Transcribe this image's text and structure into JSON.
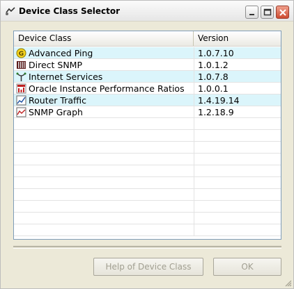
{
  "window": {
    "title": "Device Class Selector"
  },
  "list": {
    "headers": {
      "device_class": "Device Class",
      "version": "Version"
    },
    "rows": [
      {
        "name": "Advanced Ping",
        "version": "1.0.7.10",
        "icon": "advanced-ping-icon"
      },
      {
        "name": "Direct SNMP",
        "version": "1.0.1.2",
        "icon": "direct-snmp-icon"
      },
      {
        "name": "Internet Services",
        "version": "1.0.7.8",
        "icon": "internet-services-icon"
      },
      {
        "name": "Oracle Instance Performance Ratios",
        "version": "1.0.0.1",
        "icon": "oracle-icon"
      },
      {
        "name": "Router Traffic",
        "version": "1.4.19.14",
        "icon": "router-traffic-icon"
      },
      {
        "name": "SNMP Graph",
        "version": "1.2.18.9",
        "icon": "snmp-graph-icon"
      }
    ]
  },
  "buttons": {
    "help_label": "Help of Device Class",
    "ok_label": "OK"
  },
  "colors": {
    "row_highlight": "#dbf5fb",
    "disabled_text": "#a19f91",
    "close_button": "#cd4b30"
  }
}
